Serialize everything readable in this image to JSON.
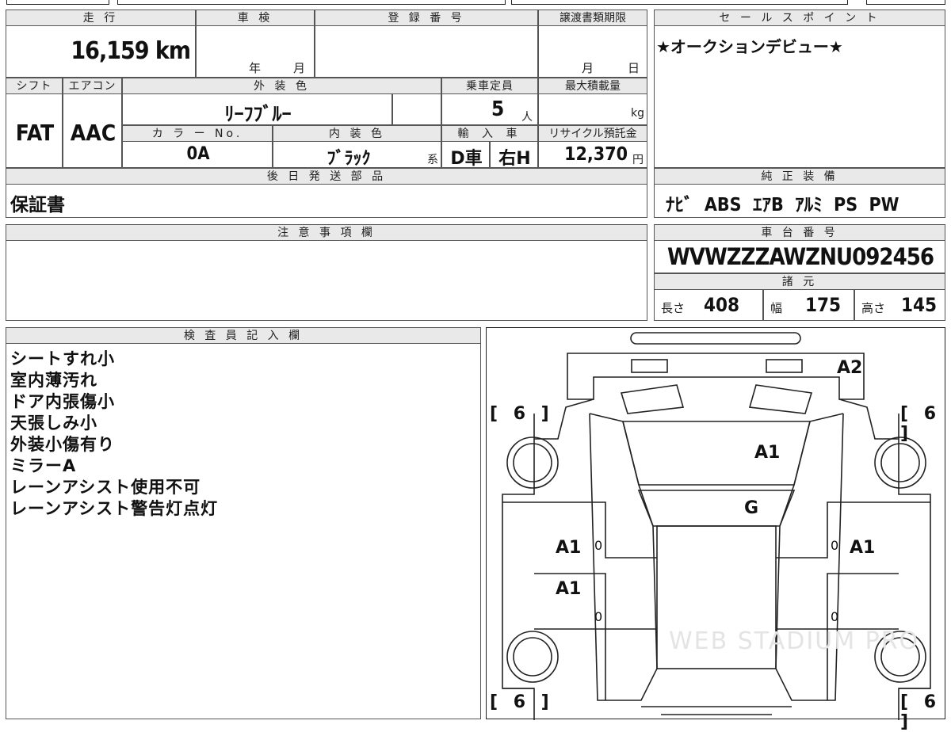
{
  "top": {
    "mileage_header": "走 行",
    "mileage_value": "16,159 km",
    "shaken_header": "車 検",
    "shaken_year": "年",
    "shaken_month": "月",
    "reg_header": "登 録 番 号",
    "transfer_header": "譲渡書類期限",
    "transfer_month": "月",
    "transfer_day": "日",
    "shift_header": "シフト",
    "shift_value": "FAT",
    "ac_header": "エアコン",
    "ac_value": "AAC",
    "exterior_header": "外 装 色",
    "exterior_value": "ﾘｰﾌﾌﾞﾙｰ",
    "capacity_header": "乗車定員",
    "capacity_value": "5",
    "capacity_unit": "人",
    "maxload_header": "最大積載量",
    "maxload_unit": "kg",
    "color_no_header": "カ ラ ー No.",
    "color_no_value": "0A",
    "interior_header": "内 装 色",
    "interior_value": "ﾌﾞﾗｯｸ",
    "interior_suffix": "系",
    "import_header": "輸 入 車",
    "import_value": "D車",
    "steering_value": "右H",
    "recycle_header": "リサイクル預託金",
    "recycle_value": "12,370",
    "recycle_unit": "円",
    "parts_header": "後 日 発 送 部 品",
    "parts_value": "保証書"
  },
  "sales": {
    "header": "セ ー ル ス ポ イ ン ト",
    "text": "★オークションデビュー★",
    "equip_header": "純 正 装 備",
    "equip_value": "ﾅﾋﾞ  ABS  ｴｱB  ｱﾙﾐ  PS  PW"
  },
  "caution": {
    "header": "注 意 事 項 欄"
  },
  "chassis": {
    "header": "車 台 番 号",
    "value": "WVWZZZAWZNU092456",
    "spec_header": "諸 元",
    "length_label": "長さ",
    "length_value": "408",
    "width_label": "幅",
    "width_value": "175",
    "height_label": "高さ",
    "height_value": "145"
  },
  "inspector": {
    "header": "検 査 員 記 入 欄",
    "notes": [
      "シートすれ小",
      "室内薄汚れ",
      "ドア内張傷小",
      "天張しみ小",
      "外装小傷有り",
      "ミラーA",
      "レーンアシスト使用不可",
      "レーンアシスト警告灯点灯"
    ]
  },
  "diagram": {
    "tire_tl": "[ 6 ]",
    "tire_tr": "[ 6 ]",
    "tire_bl": "[ 6 ]",
    "tire_br": "[ 6 ]",
    "mark_rear": "A2",
    "mark_roof": "A1",
    "mark_glass": "G",
    "mark_door_lf": "A1",
    "mark_door_lr": "A1",
    "mark_door_rf": "A1",
    "zero_lf": "0",
    "zero_lr": "0",
    "zero_rf": "0",
    "zero_rr": "0",
    "watermark": "WEB STADIUM PRO"
  }
}
